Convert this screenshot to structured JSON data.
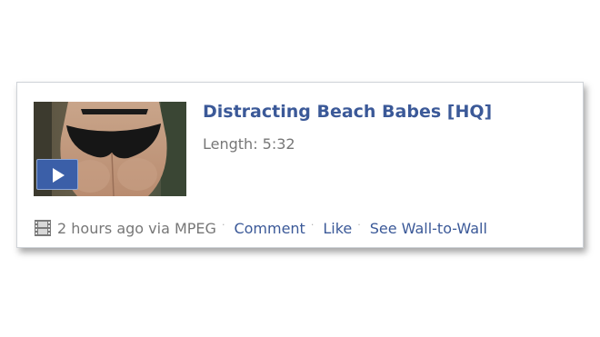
{
  "post": {
    "title": "Distracting Beach Babes [HQ]",
    "length": "Length: 5:32",
    "thumbnail_icon": "play-icon",
    "footer": {
      "media_icon": "film-icon",
      "timestamp": "2 hours ago via MPEG",
      "separator": "·",
      "comment_label": "Comment",
      "like_label": "Like",
      "wall_label": "See Wall-to-Wall"
    }
  },
  "colors": {
    "link": "#3b5998",
    "meta_text": "#777777",
    "play_button": "#3b5fa8"
  }
}
